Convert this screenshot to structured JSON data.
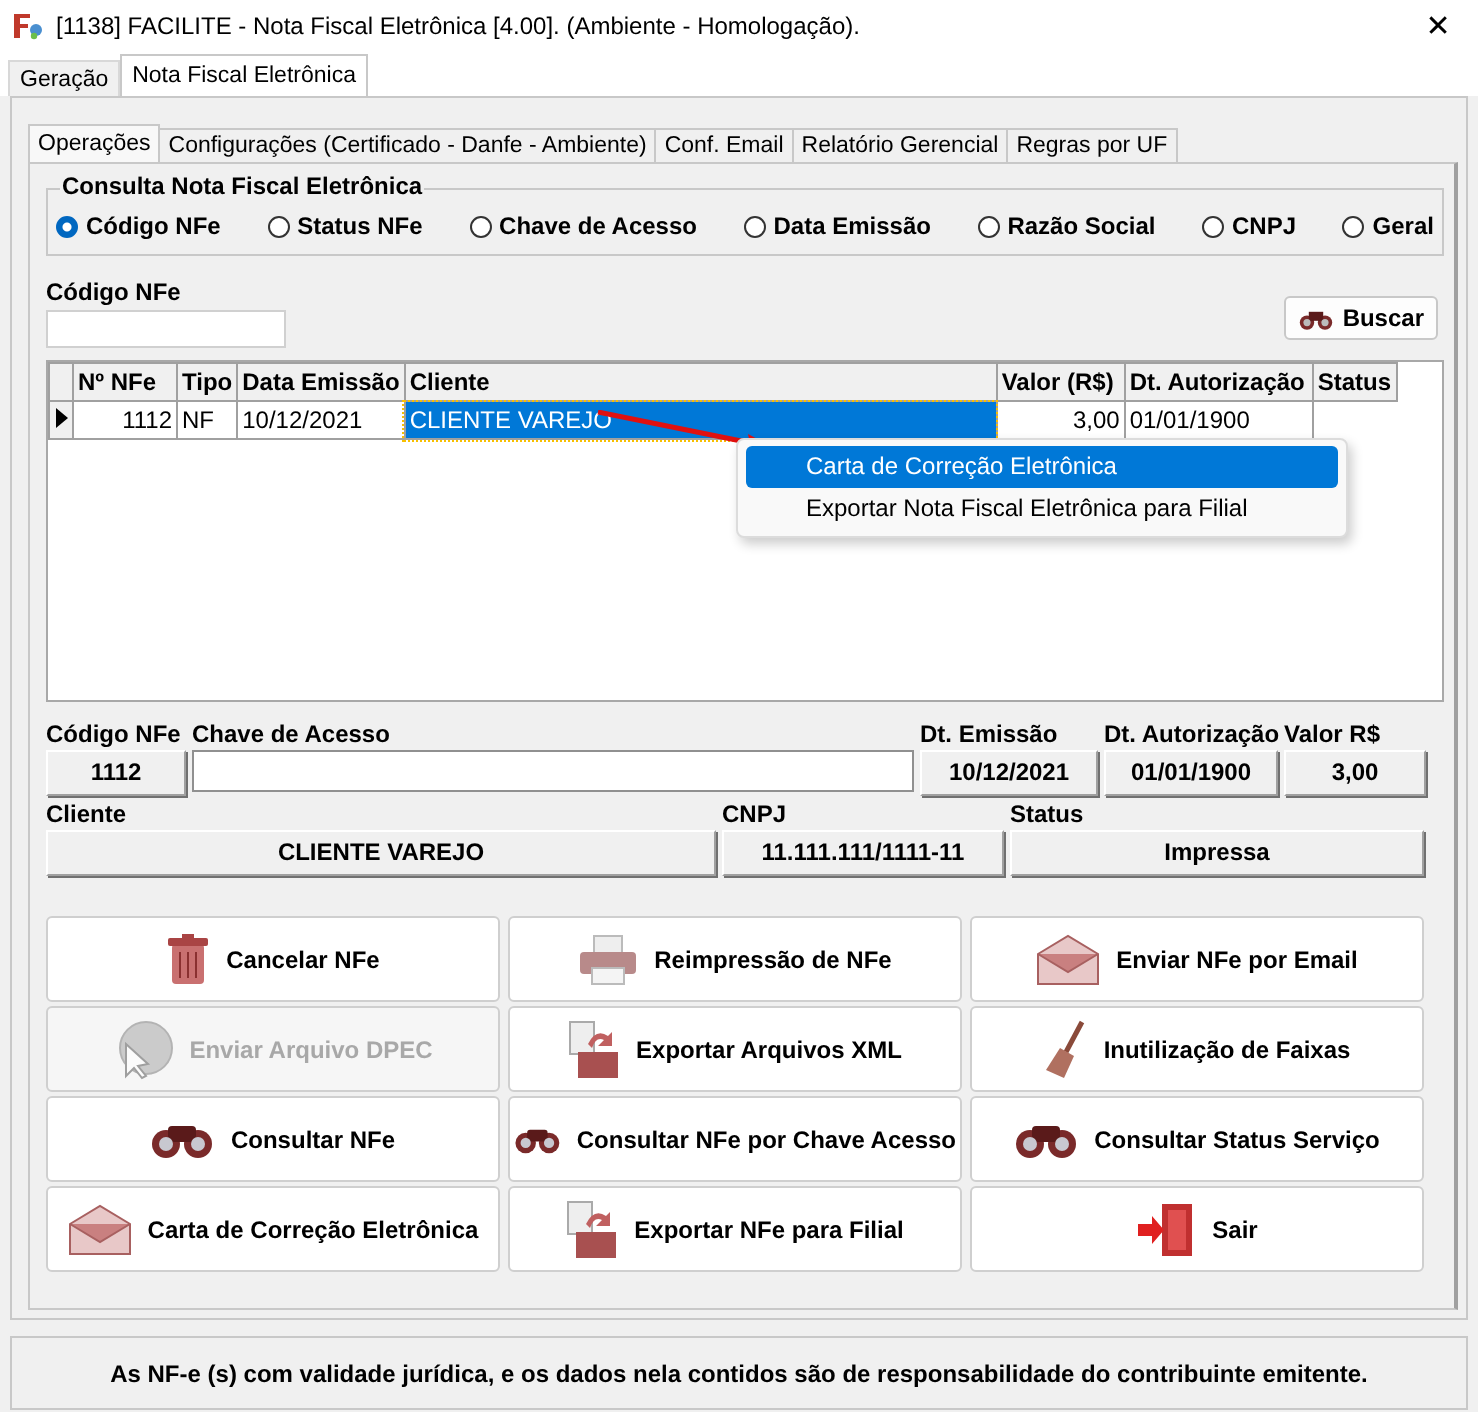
{
  "window": {
    "title": "[1138] FACILITE - Nota Fiscal Eletrônica [4.00]. (Ambiente - Homologação).",
    "close": "✕"
  },
  "outer_tabs": [
    {
      "label": "Geração",
      "selected": false
    },
    {
      "label": "Nota Fiscal Eletrônica",
      "selected": true
    }
  ],
  "inner_tabs": [
    {
      "label": "Operações",
      "selected": true
    },
    {
      "label": "Configurações (Certificado - Danfe - Ambiente)",
      "selected": false
    },
    {
      "label": "Conf. Email",
      "selected": false
    },
    {
      "label": "Relatório Gerencial",
      "selected": false
    },
    {
      "label": "Regras por UF",
      "selected": false
    }
  ],
  "search_group": {
    "title": "Consulta Nota Fiscal Eletrônica",
    "options": [
      {
        "label": "Código NFe",
        "selected": true
      },
      {
        "label": "Status NFe",
        "selected": false
      },
      {
        "label": "Chave de Acesso",
        "selected": false
      },
      {
        "label": "Data Emissão",
        "selected": false
      },
      {
        "label": "Razão Social",
        "selected": false
      },
      {
        "label": "CNPJ",
        "selected": false
      },
      {
        "label": "Geral",
        "selected": false
      }
    ]
  },
  "search_field": {
    "label": "Código NFe"
  },
  "search_button": "Buscar",
  "table": {
    "columns": [
      "Nº NFe",
      "Tipo",
      "Data Emissão",
      "Cliente",
      "Valor (R$)",
      "Dt. Autorização",
      "Status"
    ],
    "rows": [
      {
        "selected": true,
        "cells": [
          "1112",
          "NF",
          "10/12/2021",
          "CLIENTE VAREJO",
          "3,00",
          "01/01/1900"
        ]
      }
    ]
  },
  "context_menu": [
    {
      "label": "Carta de Correção Eletrônica",
      "selected": true
    },
    {
      "label": "Exportar Nota Fiscal Eletrônica para Filial",
      "selected": false
    }
  ],
  "detail_rows": [
    [
      {
        "label": "Código NFe",
        "value": "1112",
        "kind": "display"
      },
      {
        "label": "Chave de Acesso",
        "kind": "input"
      },
      {
        "label": "Dt. Emissão",
        "value": "10/12/2021",
        "kind": "display"
      },
      {
        "label": "Dt. Autorização",
        "value": "01/01/1900",
        "kind": "display"
      },
      {
        "label": "Valor R$",
        "value": "3,00",
        "kind": "display"
      }
    ],
    [
      {
        "label": "Cliente",
        "value": "CLIENTE VAREJO",
        "kind": "display"
      },
      {
        "label": "CNPJ",
        "value": "11.111.111/1111-11",
        "kind": "display"
      },
      {
        "label": "Status",
        "value": "Impressa",
        "kind": "display"
      }
    ]
  ],
  "actions": [
    {
      "label": "Cancelar NFe",
      "disabled": false
    },
    {
      "label": "Reimpressão de NFe",
      "disabled": false
    },
    {
      "label": "Enviar NFe por Email",
      "disabled": false
    },
    {
      "label": "Enviar Arquivo DPEC",
      "disabled": true
    },
    {
      "label": "Exportar Arquivos XML",
      "disabled": false
    },
    {
      "label": "Inutilização de Faixas",
      "disabled": false
    },
    {
      "label": "Consultar NFe",
      "disabled": false
    },
    {
      "label": "Consultar NFe por Chave Acesso",
      "disabled": false
    },
    {
      "label": "Consultar Status Serviço",
      "disabled": false
    },
    {
      "label": "Carta de Correção Eletrônica",
      "disabled": false
    },
    {
      "label": "Exportar NFe para Filial",
      "disabled": false
    },
    {
      "label": "Sair",
      "disabled": false
    }
  ],
  "status_bar": "As NF-e (s) com validade jurídica, e os dados nela contidos são de responsabilidade do contribuinte emitente."
}
